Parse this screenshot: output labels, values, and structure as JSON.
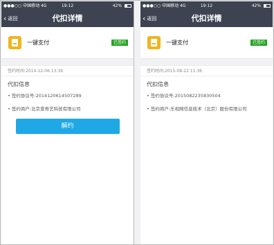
{
  "left": {
    "status": {
      "carrier": "●●●○○ 中国移动  4G",
      "time": "19:12",
      "battery": "42%"
    },
    "nav": {
      "back_label": "返回",
      "title": "代扣详情"
    },
    "pay": {
      "name": "一键支付",
      "badge": "已签约"
    },
    "sign_time": "签约时间:2014-12-06 13:39",
    "info": {
      "title": "代扣信息",
      "agreement": "• 签约协议号:2014120614507289",
      "merchant": "• 签约商户:北京爱奇艺科技有限公司"
    },
    "cancel_label": "解约"
  },
  "right": {
    "status": {
      "carrier": "●●●○○ 中国移动  4G",
      "time": "19:12",
      "battery": "42%"
    },
    "nav": {
      "back_label": "返回",
      "title": "代扣详情"
    },
    "pay": {
      "name": "一键支付",
      "badge": "已签约"
    },
    "sign_time": "签约时间:2015-08-22 11:36",
    "info": {
      "title": "代扣信息",
      "agreement": "• 签约协议号:2015082235830504",
      "merchant": "• 签约商户:乐视网信息技术（北京）股份有限公司"
    }
  },
  "colors": {
    "navbar": "#3d4350",
    "badge": "#24a522",
    "button": "#1ea9e6",
    "pay_icon": "#f0b51e"
  }
}
